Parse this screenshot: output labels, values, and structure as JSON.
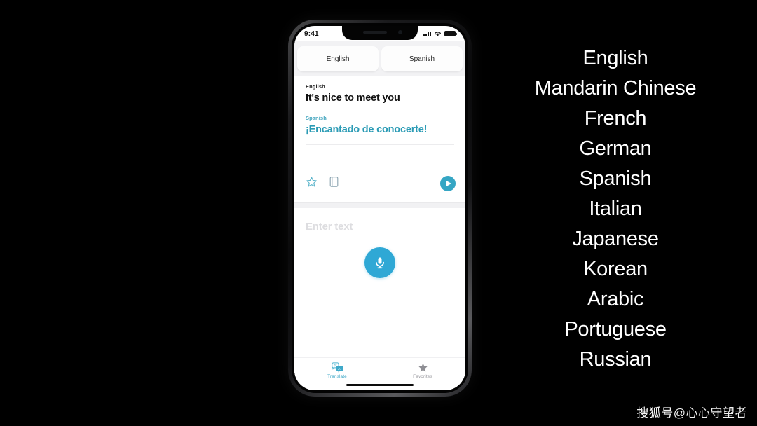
{
  "background_color": "#000000",
  "phone": {
    "status_bar": {
      "time": "9:41",
      "icons": [
        "signal-icon",
        "wifi-icon",
        "battery-icon"
      ]
    },
    "language_selector": {
      "source_language": "English",
      "target_language": "Spanish"
    },
    "translation_card": {
      "source_label": "English",
      "source_text": "It's nice to meet you",
      "target_label": "Spanish",
      "target_text": "¡Encantado de conocerte!",
      "target_text_color": "#2b9bb5",
      "actions": {
        "favorite": "star-outline-icon",
        "dictionary": "book-outline-icon",
        "play": "play-icon",
        "play_color": "#35a6c4"
      }
    },
    "input_area": {
      "placeholder": "Enter text",
      "mic_label": "microphone-icon",
      "mic_color": "#2fa8d5"
    },
    "tab_bar": {
      "tabs": [
        {
          "label": "Translate",
          "icon": "translate-icon",
          "active": true
        },
        {
          "label": "Favorites",
          "icon": "star-icon",
          "active": false
        }
      ],
      "active_color": "#3aa6c6",
      "inactive_color": "#9a9aa0"
    }
  },
  "language_list": {
    "items": [
      "English",
      "Mandarin Chinese",
      "French",
      "German",
      "Spanish",
      "Italian",
      "Japanese",
      "Korean",
      "Arabic",
      "Portuguese",
      "Russian"
    ]
  },
  "watermark": {
    "text": "搜狐号@心心守望者"
  }
}
